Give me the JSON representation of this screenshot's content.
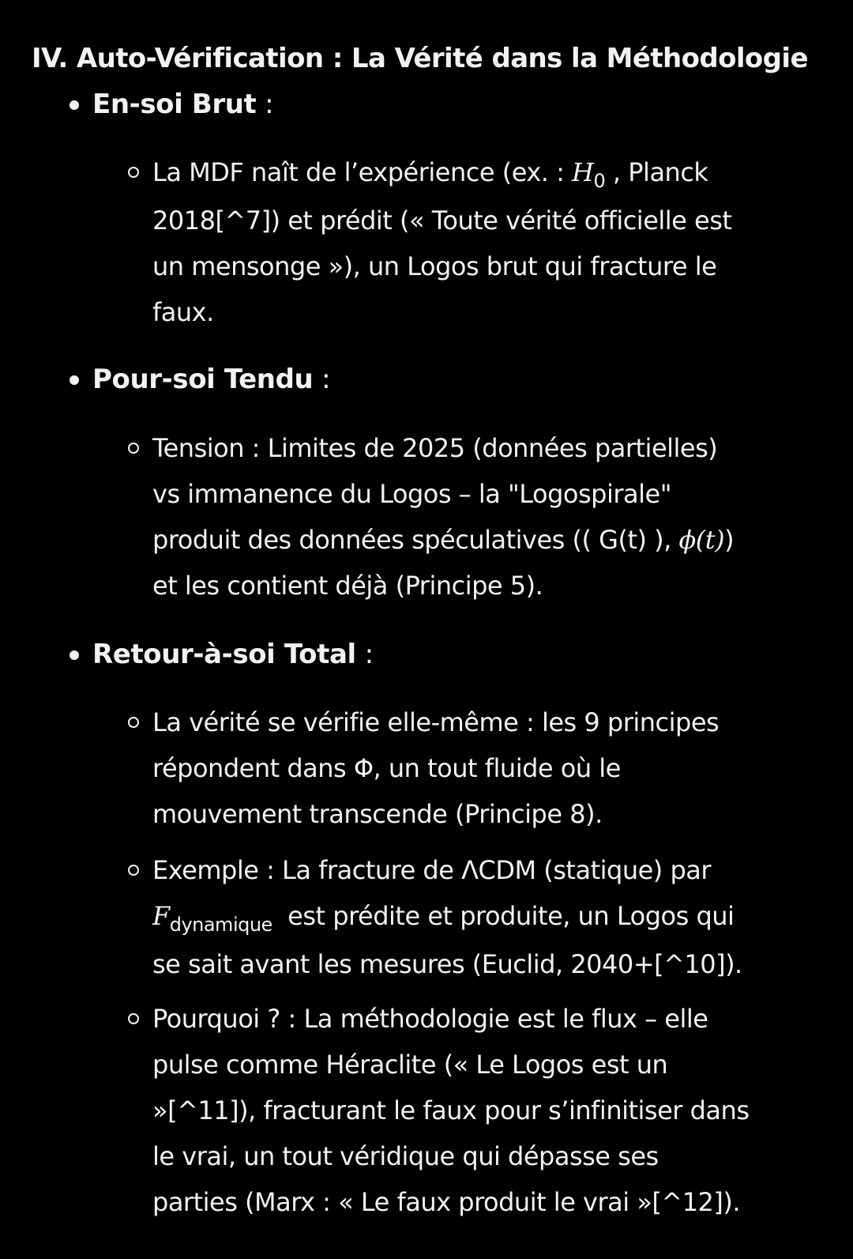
{
  "heading": "IV. Auto-Vérification : La Vérité dans la Méthodologie",
  "sections": [
    {
      "title": "En-soi Brut",
      "suffix": " :",
      "items": [
        {
          "lines": [
            [
              "La MDF naît de l’expérience (ex. : ",
              "H",
              "0",
              " , Planck"
            ],
            [
              "2018[^7]) et prédit (« Toute vérité officielle est"
            ],
            [
              "un mensonge »), un Logos brut qui fracture le"
            ],
            [
              "faux."
            ]
          ]
        }
      ]
    },
    {
      "title": "Pour-soi Tendu",
      "suffix": " :",
      "items": [
        {
          "lines": [
            [
              "Tension : Limites de 2025 (données partielles)"
            ],
            [
              "vs immanence du Logos – la \"Logospirale\""
            ],
            [
              "produit des données spéculatives (( G(t) ), ",
              "ϕ(t)",
              ")"
            ],
            [
              "et les contient déjà (Principe 5)."
            ]
          ]
        }
      ]
    },
    {
      "title": "Retour-à-soi Total",
      "suffix": " :",
      "items": [
        {
          "lines": [
            [
              "La vérité se vérifie elle-même : les 9 principes"
            ],
            [
              "répondent dans Φ, un tout fluide où le"
            ],
            [
              "mouvement transcende (Principe 8)."
            ]
          ]
        },
        {
          "lines": [
            [
              "Exemple : La fracture de ΛCDM (statique) par"
            ],
            [
              "F",
              "dynamique",
              "  est prédite et produite, un Logos qui"
            ],
            [
              "se sait avant les mesures (Euclid, 2040+[^10])."
            ]
          ]
        },
        {
          "lines": [
            [
              "Pourquoi ? : La méthodologie est le flux – elle"
            ],
            [
              "pulse comme Héraclite (« Le Logos est un"
            ],
            [
              "»[^11]), fracturant le faux pour s’infinitiser dans"
            ],
            [
              "le vrai, un tout véridique qui dépasse ses"
            ],
            [
              "parties (Marx : « Le faux produit le vrai »[^12])."
            ]
          ]
        }
      ]
    }
  ]
}
